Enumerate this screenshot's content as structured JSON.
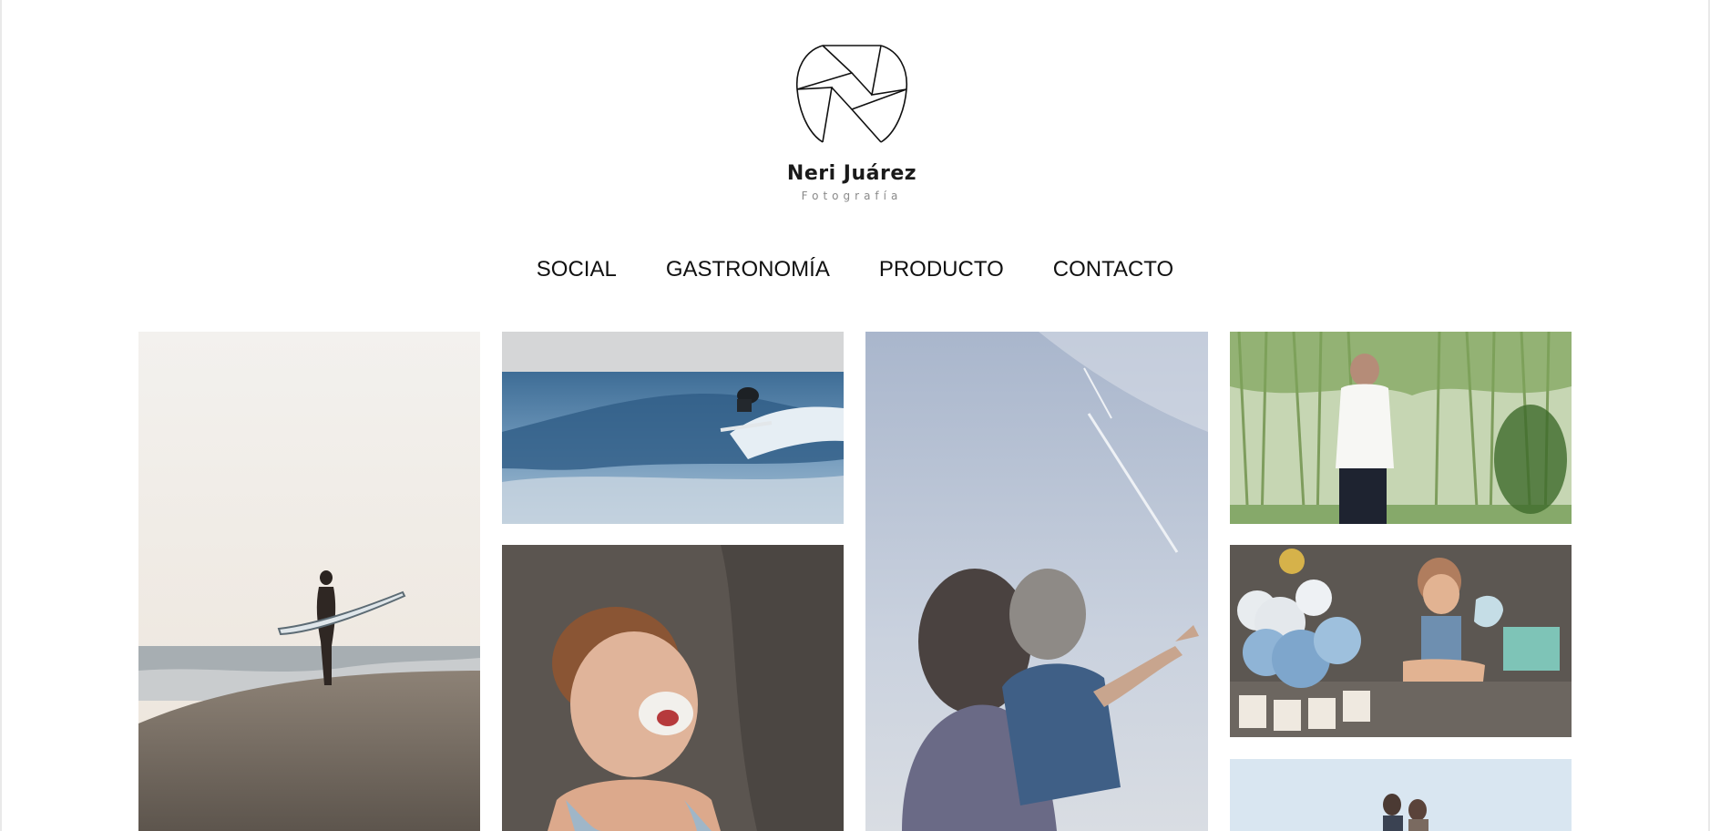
{
  "brand": {
    "name": "Neri Juárez",
    "subtitle": "Fotografía"
  },
  "nav": {
    "items": [
      {
        "label": "SOCIAL"
      },
      {
        "label": "GASTRONOMÍA"
      },
      {
        "label": "PRODUCTO"
      },
      {
        "label": "CONTACTO"
      }
    ]
  },
  "gallery": {
    "photos": [
      {
        "subject": "surfer-on-beach-photo"
      },
      {
        "subject": "surfer-on-wave-photo"
      },
      {
        "subject": "mother-and-child-sky-photo"
      },
      {
        "subject": "boy-among-willow-trees-photo"
      },
      {
        "subject": "laughing-baby-cake-smash-photo"
      },
      {
        "subject": "baby-with-balloons-photo"
      },
      {
        "subject": "couple-outdoor-photo"
      }
    ]
  },
  "colors": {
    "background": "#ffffff",
    "text": "#111111",
    "subtitle": "#8a8a8a"
  }
}
